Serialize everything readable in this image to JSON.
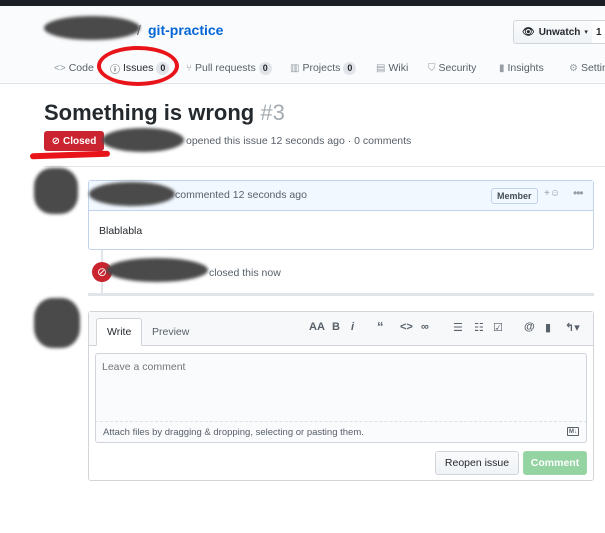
{
  "repo": {
    "name": "git-practice",
    "unwatch_label": "Unwatch",
    "unwatch_count": "1"
  },
  "tabs": [
    {
      "label": "Code",
      "icon": "code-icon"
    },
    {
      "label": "Issues",
      "count": "0",
      "icon": "issue-icon"
    },
    {
      "label": "Pull requests",
      "count": "0",
      "icon": "pull-request-icon"
    },
    {
      "label": "Projects",
      "count": "0",
      "icon": "project-icon"
    },
    {
      "label": "Wiki",
      "icon": "book-icon"
    },
    {
      "label": "Security",
      "icon": "shield-icon"
    },
    {
      "label": "Insights",
      "icon": "graph-icon"
    },
    {
      "label": "Settings",
      "icon": "gear-icon"
    }
  ],
  "issue": {
    "title": "Something is wrong",
    "number": "#3",
    "state": "Closed",
    "meta": "opened this issue 12 seconds ago · 0 comments"
  },
  "comment": {
    "meta": "commented 12 seconds ago",
    "role": "Member",
    "body": "Blablabla"
  },
  "event": {
    "text": "closed this now"
  },
  "editor": {
    "tab_write": "Write",
    "tab_preview": "Preview",
    "placeholder": "Leave a comment",
    "attach_hint": "Attach files by dragging & dropping, selecting or pasting them.",
    "reopen_label": "Reopen issue",
    "comment_label": "Comment"
  },
  "colors": {
    "link": "#0366d6",
    "closed": "#cb2431",
    "comment_header_bg": "#f1f8ff",
    "disabled_green": "#94d3a2",
    "annotation_red": "#e8141a"
  }
}
